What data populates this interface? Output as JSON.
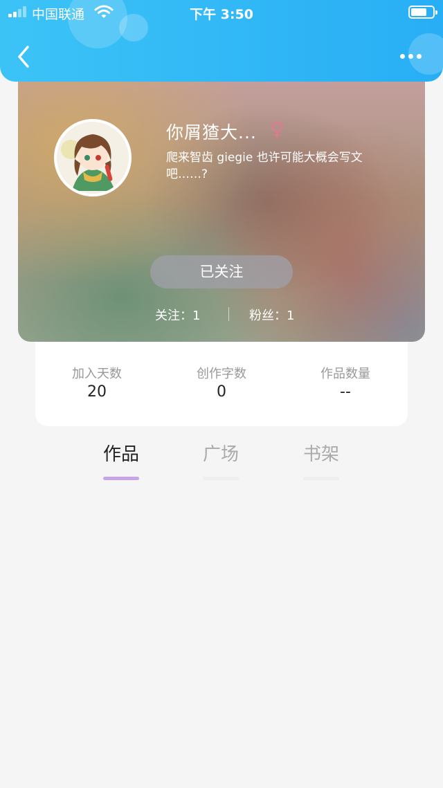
{
  "status_bar": {
    "carrier": "中国联通",
    "time": "下午 3:50",
    "signal_bars": 4,
    "signal_filled": 2,
    "battery_level": 0.65
  },
  "header": {
    "back_icon": "chevron-left-icon",
    "more_icon": "more-horizontal-icon"
  },
  "profile": {
    "username": "你屑猹大...",
    "gender_symbol": "♀",
    "gender_color": "#e07a8f",
    "bio": "爬来智齿 giegie  也许可能大概会写文吧……?",
    "follow_button": "已关注",
    "following_text": "关注：1",
    "fans_text": "粉丝：1"
  },
  "stats": [
    {
      "label": "加入天数",
      "value": "20"
    },
    {
      "label": "创作字数",
      "value": "0"
    },
    {
      "label": "作品数量",
      "value": "--"
    }
  ],
  "tabs": [
    {
      "label": "作品",
      "active": true
    },
    {
      "label": "广场",
      "active": false
    },
    {
      "label": "书架",
      "active": false
    }
  ],
  "colors": {
    "header_start": "#3cc3f6",
    "header_end": "#28aef5",
    "tab_underline_active": "#c7a5e8"
  }
}
